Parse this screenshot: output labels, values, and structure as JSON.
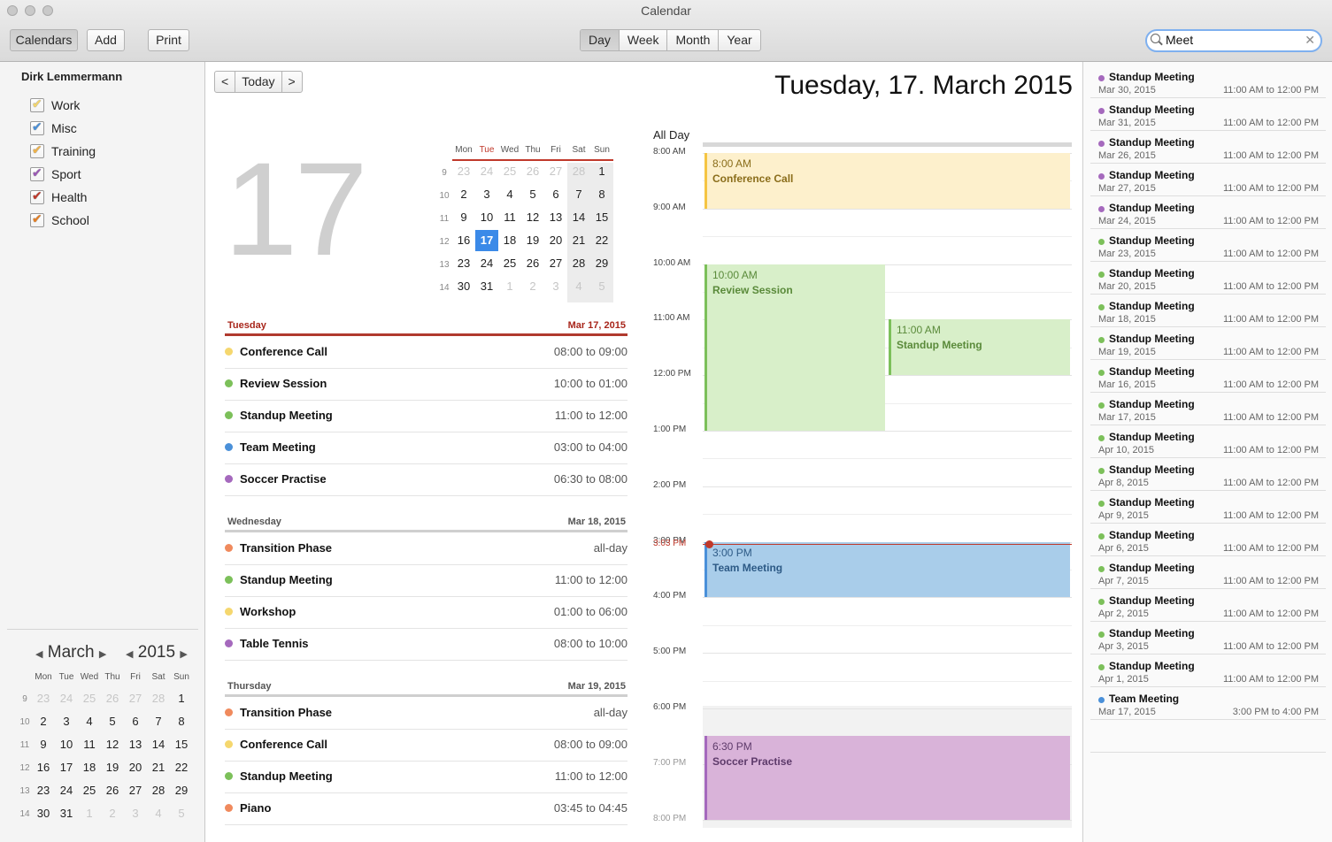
{
  "window": {
    "title": "Calendar"
  },
  "toolbar": {
    "calendars_label": "Calendars",
    "add_label": "Add",
    "print_label": "Print",
    "views": [
      "Day",
      "Week",
      "Month",
      "Year"
    ],
    "active_view": "Day",
    "search_value": "Meet"
  },
  "sidebar": {
    "owner": "Dirk Lemmermann",
    "calendars": [
      {
        "label": "Work",
        "color": "#f5d76e"
      },
      {
        "label": "Misc",
        "color": "#4a90d9"
      },
      {
        "label": "Training",
        "color": "#f0b34a"
      },
      {
        "label": "Sport",
        "color": "#9b59b6"
      },
      {
        "label": "Health",
        "color": "#c0392b"
      },
      {
        "label": "School",
        "color": "#e67e22"
      }
    ],
    "mini_month": "March",
    "mini_year": "2015",
    "weekdays": [
      "Mon",
      "Tue",
      "Wed",
      "Thu",
      "Fri",
      "Sat",
      "Sun"
    ],
    "weeks": [
      {
        "wk": "9",
        "days": [
          "23",
          "24",
          "25",
          "26",
          "27",
          "28",
          "1"
        ],
        "dim": [
          1,
          1,
          1,
          1,
          1,
          1,
          0
        ]
      },
      {
        "wk": "10",
        "days": [
          "2",
          "3",
          "4",
          "5",
          "6",
          "7",
          "8"
        ],
        "dim": [
          0,
          0,
          0,
          0,
          0,
          0,
          0
        ]
      },
      {
        "wk": "11",
        "days": [
          "9",
          "10",
          "11",
          "12",
          "13",
          "14",
          "15"
        ],
        "dim": [
          0,
          0,
          0,
          0,
          0,
          0,
          0
        ]
      },
      {
        "wk": "12",
        "days": [
          "16",
          "17",
          "18",
          "19",
          "20",
          "21",
          "22"
        ],
        "dim": [
          0,
          0,
          0,
          0,
          0,
          0,
          0
        ]
      },
      {
        "wk": "13",
        "days": [
          "23",
          "24",
          "25",
          "26",
          "27",
          "28",
          "29"
        ],
        "dim": [
          0,
          0,
          0,
          0,
          0,
          0,
          0
        ]
      },
      {
        "wk": "14",
        "days": [
          "30",
          "31",
          "1",
          "2",
          "3",
          "4",
          "5"
        ],
        "dim": [
          0,
          0,
          1,
          1,
          1,
          1,
          1
        ]
      }
    ]
  },
  "nav": {
    "prev": "<",
    "today": "Today",
    "next": ">"
  },
  "date_heading": "Tuesday, 17. March 2015",
  "big_day": "17",
  "day_calendar": {
    "weekdays": [
      "Mon",
      "Tue",
      "Wed",
      "Thu",
      "Fri",
      "Sat",
      "Sun"
    ],
    "weeks": [
      {
        "wk": "9",
        "days": [
          "23",
          "24",
          "25",
          "26",
          "27",
          "28",
          "1"
        ],
        "dim": [
          1,
          1,
          1,
          1,
          1,
          1,
          0
        ]
      },
      {
        "wk": "10",
        "days": [
          "2",
          "3",
          "4",
          "5",
          "6",
          "7",
          "8"
        ],
        "dim": [
          0,
          0,
          0,
          0,
          0,
          0,
          0
        ]
      },
      {
        "wk": "11",
        "days": [
          "9",
          "10",
          "11",
          "12",
          "13",
          "14",
          "15"
        ],
        "dim": [
          0,
          0,
          0,
          0,
          0,
          0,
          0
        ]
      },
      {
        "wk": "12",
        "days": [
          "16",
          "17",
          "18",
          "19",
          "20",
          "21",
          "22"
        ],
        "dim": [
          0,
          0,
          0,
          0,
          0,
          0,
          0
        ]
      },
      {
        "wk": "13",
        "days": [
          "23",
          "24",
          "25",
          "26",
          "27",
          "28",
          "29"
        ],
        "dim": [
          0,
          0,
          0,
          0,
          0,
          0,
          0
        ]
      },
      {
        "wk": "14",
        "days": [
          "30",
          "31",
          "1",
          "2",
          "3",
          "4",
          "5"
        ],
        "dim": [
          0,
          0,
          1,
          1,
          1,
          1,
          1
        ]
      }
    ],
    "selected": "17"
  },
  "agenda": [
    {
      "day": "Tuesday",
      "date": "Mar 17, 2015",
      "accent": "#b03a2e",
      "events": [
        {
          "name": "Conference Call",
          "time": "08:00 to 09:00",
          "color": "#f5d76e"
        },
        {
          "name": "Review Session",
          "time": "10:00 to 01:00",
          "color": "#7cc05a"
        },
        {
          "name": "Standup Meeting",
          "time": "11:00 to 12:00",
          "color": "#7cc05a"
        },
        {
          "name": "Team Meeting",
          "time": "03:00 to 04:00",
          "color": "#4a90d9"
        },
        {
          "name": "Soccer Practise",
          "time": "06:30 to 08:00",
          "color": "#a569bd"
        }
      ]
    },
    {
      "day": "Wednesday",
      "date": "Mar 18, 2015",
      "accent": "#cfcfcf",
      "events": [
        {
          "name": "Transition Phase",
          "time": "all-day",
          "color": "#f08a5d"
        },
        {
          "name": "Standup Meeting",
          "time": "11:00 to 12:00",
          "color": "#7cc05a"
        },
        {
          "name": "Workshop",
          "time": "01:00 to 06:00",
          "color": "#f5d76e"
        },
        {
          "name": "Table Tennis",
          "time": "08:00 to 10:00",
          "color": "#a569bd"
        }
      ]
    },
    {
      "day": "Thursday",
      "date": "Mar 19, 2015",
      "accent": "#cfcfcf",
      "events": [
        {
          "name": "Transition Phase",
          "time": "all-day",
          "color": "#f08a5d"
        },
        {
          "name": "Conference Call",
          "time": "08:00 to 09:00",
          "color": "#f5d76e"
        },
        {
          "name": "Standup Meeting",
          "time": "11:00 to 12:00",
          "color": "#7cc05a"
        },
        {
          "name": "Piano",
          "time": "03:45 to 04:45",
          "color": "#f08a5d"
        }
      ]
    }
  ],
  "dayview": {
    "all_day_label": "All Day",
    "hours": [
      "8:00 AM",
      "9:00 AM",
      "10:00 AM",
      "11:00 AM",
      "12:00 PM",
      "1:00 PM",
      "2:00 PM",
      "3:00 PM",
      "4:00 PM",
      "5:00 PM",
      "6:00 PM",
      "7:00 PM",
      "8:00 PM"
    ],
    "now_label": "3:03 PM",
    "events": [
      {
        "time": "8:00 AM",
        "name": "Conference Call",
        "bg": "#fdf0cc",
        "border": "#f5c542",
        "fg": "#8a6d1a"
      },
      {
        "time": "10:00 AM",
        "name": "Review Session",
        "bg": "#d8efc9",
        "border": "#7cc05a",
        "fg": "#5a8a3a"
      },
      {
        "time": "11:00 AM",
        "name": "Standup Meeting",
        "bg": "#d8efc9",
        "border": "#7cc05a",
        "fg": "#5a8a3a"
      },
      {
        "time": "3:00 PM",
        "name": "Team Meeting",
        "bg": "#a9cdea",
        "border": "#4a90d9",
        "fg": "#2d5a86"
      },
      {
        "time": "6:30 PM",
        "name": "Soccer Practise",
        "bg": "#d9b3d9",
        "border": "#a569bd",
        "fg": "#5d3a6a"
      }
    ]
  },
  "results": [
    {
      "name": "Standup Meeting",
      "date": "Mar 30, 2015",
      "time": "11:00 AM to 12:00 PM",
      "color": "#a569bd"
    },
    {
      "name": "Standup Meeting",
      "date": "Mar 31, 2015",
      "time": "11:00 AM to 12:00 PM",
      "color": "#a569bd"
    },
    {
      "name": "Standup Meeting",
      "date": "Mar 26, 2015",
      "time": "11:00 AM to 12:00 PM",
      "color": "#a569bd"
    },
    {
      "name": "Standup Meeting",
      "date": "Mar 27, 2015",
      "time": "11:00 AM to 12:00 PM",
      "color": "#a569bd"
    },
    {
      "name": "Standup Meeting",
      "date": "Mar 24, 2015",
      "time": "11:00 AM to 12:00 PM",
      "color": "#a569bd"
    },
    {
      "name": "Standup Meeting",
      "date": "Mar 23, 2015",
      "time": "11:00 AM to 12:00 PM",
      "color": "#7cc05a"
    },
    {
      "name": "Standup Meeting",
      "date": "Mar 20, 2015",
      "time": "11:00 AM to 12:00 PM",
      "color": "#7cc05a"
    },
    {
      "name": "Standup Meeting",
      "date": "Mar 18, 2015",
      "time": "11:00 AM to 12:00 PM",
      "color": "#7cc05a"
    },
    {
      "name": "Standup Meeting",
      "date": "Mar 19, 2015",
      "time": "11:00 AM to 12:00 PM",
      "color": "#7cc05a"
    },
    {
      "name": "Standup Meeting",
      "date": "Mar 16, 2015",
      "time": "11:00 AM to 12:00 PM",
      "color": "#7cc05a"
    },
    {
      "name": "Standup Meeting",
      "date": "Mar 17, 2015",
      "time": "11:00 AM to 12:00 PM",
      "color": "#7cc05a"
    },
    {
      "name": "Standup Meeting",
      "date": "Apr 10, 2015",
      "time": "11:00 AM to 12:00 PM",
      "color": "#7cc05a"
    },
    {
      "name": "Standup Meeting",
      "date": "Apr 8, 2015",
      "time": "11:00 AM to 12:00 PM",
      "color": "#7cc05a"
    },
    {
      "name": "Standup Meeting",
      "date": "Apr 9, 2015",
      "time": "11:00 AM to 12:00 PM",
      "color": "#7cc05a"
    },
    {
      "name": "Standup Meeting",
      "date": "Apr 6, 2015",
      "time": "11:00 AM to 12:00 PM",
      "color": "#7cc05a"
    },
    {
      "name": "Standup Meeting",
      "date": "Apr 7, 2015",
      "time": "11:00 AM to 12:00 PM",
      "color": "#7cc05a"
    },
    {
      "name": "Standup Meeting",
      "date": "Apr 2, 2015",
      "time": "11:00 AM to 12:00 PM",
      "color": "#7cc05a"
    },
    {
      "name": "Standup Meeting",
      "date": "Apr 3, 2015",
      "time": "11:00 AM to 12:00 PM",
      "color": "#7cc05a"
    },
    {
      "name": "Standup Meeting",
      "date": "Apr 1, 2015",
      "time": "11:00 AM to 12:00 PM",
      "color": "#7cc05a"
    },
    {
      "name": "Team Meeting",
      "date": "Mar 17, 2015",
      "time": "3:00 PM to 4:00 PM",
      "color": "#4a90d9"
    }
  ]
}
